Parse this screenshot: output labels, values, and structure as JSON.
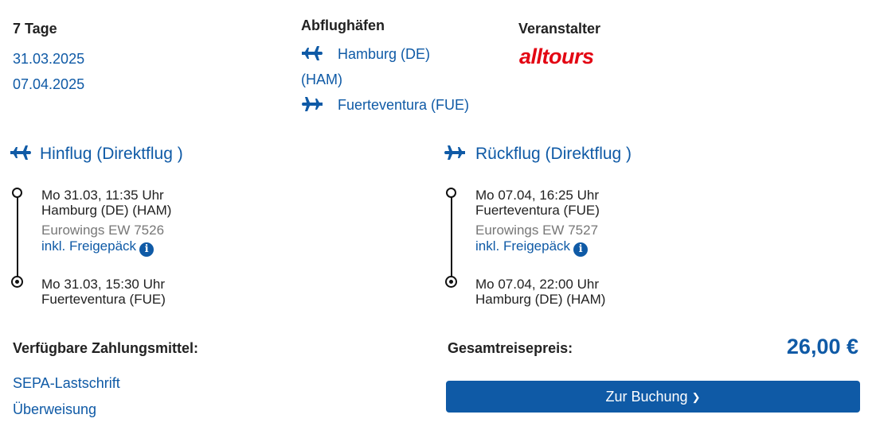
{
  "trip": {
    "duration": "7 Tage",
    "start_date": "31.03.2025",
    "end_date": "07.04.2025"
  },
  "airports": {
    "heading": "Abflughäfen",
    "departure_line1": "Hamburg (DE)",
    "departure_line2": "(HAM)",
    "arrival": "Fuerteventura (FUE)"
  },
  "operator": {
    "heading": "Veranstalter",
    "logo_text": "alltours"
  },
  "outbound": {
    "title": "Hinflug (Direktflug )",
    "dep_time": "Mo 31.03, 11:35 Uhr",
    "dep_place": "Hamburg (DE) (HAM)",
    "flight": "Eurowings EW 7526",
    "baggage": "inkl. Freigepäck",
    "arr_time": "Mo 31.03, 15:30 Uhr",
    "arr_place": "Fuerteventura (FUE)"
  },
  "return": {
    "title": "Rückflug (Direktflug )",
    "dep_time": "Mo 07.04, 16:25 Uhr",
    "dep_place": "Fuerteventura (FUE)",
    "flight": "Eurowings EW 7527",
    "baggage": "inkl. Freigepäck",
    "arr_time": "Mo 07.04, 22:00 Uhr",
    "arr_place": "Hamburg (DE) (HAM)"
  },
  "payment": {
    "heading": "Verfügbare Zahlungsmittel:",
    "methods": [
      "SEPA-Lastschrift",
      "Überweisung"
    ]
  },
  "total": {
    "label": "Gesamtreisepreis:",
    "price": "26,00 €"
  },
  "booking": {
    "button_label": "Zur Buchung",
    "arrow": "❯"
  },
  "icons": {
    "takeoff": "plane-right-icon",
    "landing": "plane-left-icon",
    "info": "info-icon"
  },
  "colors": {
    "accent": "#0f5aa6",
    "brand_logo": "#e30613"
  }
}
